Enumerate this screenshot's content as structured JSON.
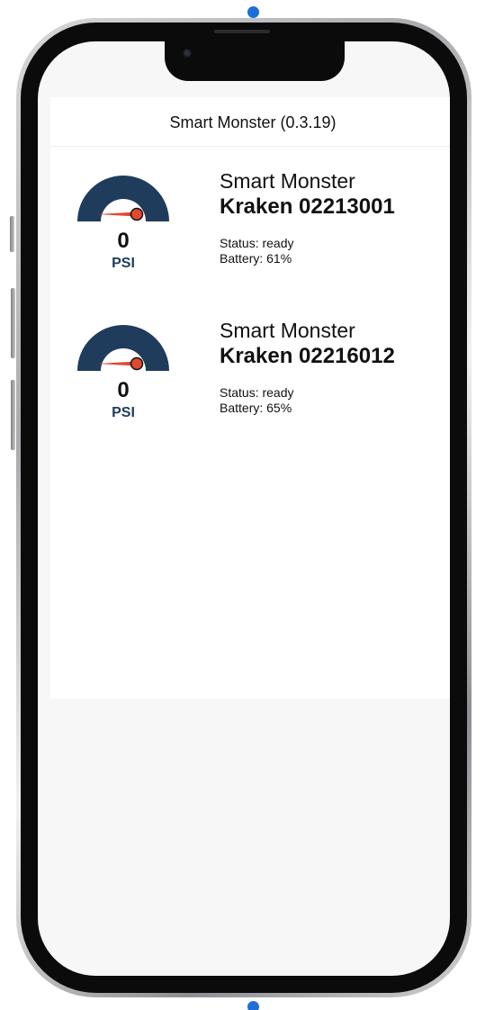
{
  "app": {
    "title": "Smart Monster (0.3.19)"
  },
  "colors": {
    "gauge_arc": "#1f3c5c",
    "gauge_needle": "#e04a2f",
    "accent_dot": "#1e6fd9"
  },
  "devices": [
    {
      "brand": "Smart Monster",
      "name": "Kraken 02213001",
      "pressure_value": "0",
      "pressure_unit": "PSI",
      "status": "Status: ready",
      "battery": "Battery: 61%"
    },
    {
      "brand": "Smart Monster",
      "name": "Kraken 02216012",
      "pressure_value": "0",
      "pressure_unit": "PSI",
      "status": "Status: ready",
      "battery": "Battery: 65%"
    }
  ]
}
